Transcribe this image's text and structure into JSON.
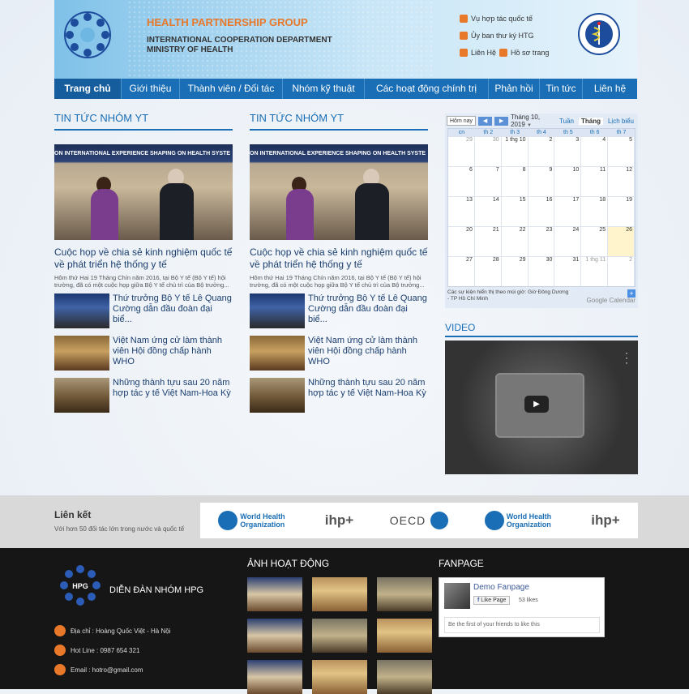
{
  "header": {
    "org_name": "HEALTH PARTNERSHIP GROUP",
    "dept_line1": "INTERNATIONAL COOPERATION DEPARTMENT",
    "dept_line2": "MINISTRY OF HEALTH",
    "top_links": {
      "intl_meeting": "Vụ hợp tác quốc tế",
      "secretariat": "Ủy ban thư ký HTG",
      "contact": "Liên Hệ",
      "profile": "Hồ sơ trang"
    }
  },
  "nav": {
    "items": [
      "Trang chủ",
      "Giới thiệu",
      "Thành viên / Đối tác",
      "Nhóm kỹ thuật",
      "Các hoạt động chính trị",
      "Phản hồi",
      "Tin tức",
      "Liên hệ"
    ]
  },
  "news_columns": [
    {
      "title": "TIN TỨC NHÓM YT",
      "banner": "ON INTERNATIONAL EXPERIENCE SHAPING ON HEALTH SYSTE",
      "main_title": "Cuộc họp về chia sẻ kinh nghiệm quốc tế về phát triển hệ thống y tế",
      "main_summary": "Hôm thứ Hai 19 Tháng Chín năm 2016, tại Bộ Y tế (Bộ Y tế) hội trường, đã có một cuộc họp giữa Bộ Y tế chủ trì của Bộ trưởng...",
      "items": [
        "Thứ trưởng Bộ Y tế Lê Quang Cường dẫn đầu đoàn đại biể...",
        "Việt Nam ứng cử làm thành viên Hội đồng chấp hành WHO",
        "Những thành tựu sau 20 năm hợp tác y tế Việt Nam-Hoa Kỳ"
      ]
    },
    {
      "title": "TIN TỨC NHÓM YT",
      "banner": "ON INTERNATIONAL EXPERIENCE SHAPING ON HEALTH SYSTE",
      "main_title": "Cuộc họp về chia sẻ kinh nghiệm quốc tế về phát triển hệ thống y tế",
      "main_summary": "Hôm thứ Hai 19 Tháng Chín năm 2016, tại Bộ Y tế (Bộ Y tế) hội trường, đã có một cuộc họp giữa Bộ Y tế chủ trì của Bộ trưởng...",
      "items": [
        "Thứ trưởng Bộ Y tế Lê Quang Cường dẫn đầu đoàn đại biể...",
        "Việt Nam ứng cử làm thành viên Hội đồng chấp hành WHO",
        "Những thành tựu sau 20 năm hợp tác y tế Việt Nam-Hoa Kỳ"
      ]
    }
  ],
  "calendar": {
    "today_label": "Hôm nay",
    "month_label": "Tháng 10, 2019",
    "tabs": [
      "Tuần",
      "Tháng",
      "Lịch biểu"
    ],
    "selected_tab": "Tháng",
    "weekdays": [
      "cn",
      "th 2",
      "th 3",
      "th 4",
      "th 5",
      "th 6",
      "th 7"
    ],
    "weeks": [
      [
        "29",
        "30",
        "1 thg 10",
        "2",
        "3",
        "4",
        "5"
      ],
      [
        "6",
        "7",
        "8",
        "9",
        "10",
        "11",
        "12"
      ],
      [
        "13",
        "14",
        "15",
        "16",
        "17",
        "18",
        "19"
      ],
      [
        "20",
        "21",
        "22",
        "23",
        "24",
        "25",
        "26"
      ],
      [
        "27",
        "28",
        "29",
        "30",
        "31",
        "1 thg 11",
        "2"
      ]
    ],
    "today": "26",
    "timezone_note": "Các sự kiện hiển thị theo múi giờ: Giờ Đông Dương - TP Hồ Chí Minh",
    "google_label": "Google Calendar"
  },
  "video": {
    "title": "VIDEO"
  },
  "links_section": {
    "title": "Liên kết",
    "subtitle": "Với hơn 50 đối tác lớn trong nước và quốc tế",
    "partners": [
      "World Health Organization",
      "ihp+",
      "OECD",
      "World Health Organization",
      "ihp+"
    ]
  },
  "footer": {
    "forum_name": "DIỄN ĐÀN NHÓM HPG",
    "address": "Địa chỉ : Hoàng Quốc Việt - Hà Nội",
    "hotline": "Hot Line : 0987 654 321",
    "email": "Email : hotro@gmail.com",
    "photos_title": "ẢNH HOẠT ĐỘNG",
    "fanpage_title": "FANPAGE",
    "fanpage": {
      "name": "Demo Fanpage",
      "like_label": "Like Page",
      "likes": "53 likes",
      "friends_text": "Be the first of your friends to like this"
    }
  }
}
